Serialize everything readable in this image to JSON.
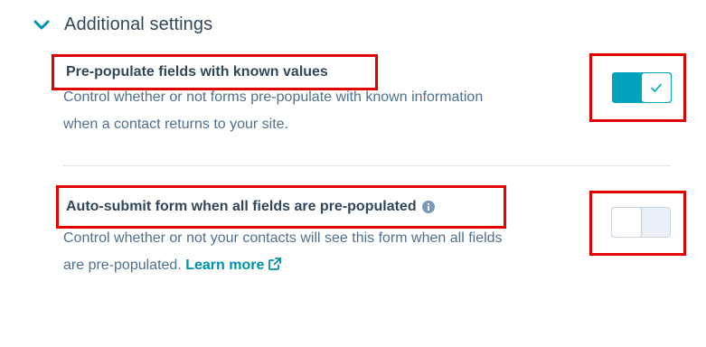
{
  "section": {
    "title": "Additional settings",
    "icon": "chevron-down-icon",
    "accent_color": "#0091ae"
  },
  "settings": [
    {
      "title": "Pre-populate fields with known values",
      "description_line1": "Control whether or not forms pre-populate with known information",
      "description_line2": "when a contact returns to your site.",
      "enabled": true,
      "toggle_icon": "check-icon"
    },
    {
      "title": "Auto-submit form when all fields are pre-populated",
      "title_icon": "info-icon",
      "description_line1": "Control whether or not your contacts will see this form when all fields",
      "description_line2_prefix": "are pre-populated.",
      "link_label": "Learn more",
      "link_icon": "external-link-icon",
      "enabled": false
    }
  ],
  "colors": {
    "toggle_on": "#00a4bd",
    "toggle_off": "#eaf0f6",
    "highlight_box": "#e00000",
    "text": "#33475b",
    "muted_text": "#516f90"
  }
}
